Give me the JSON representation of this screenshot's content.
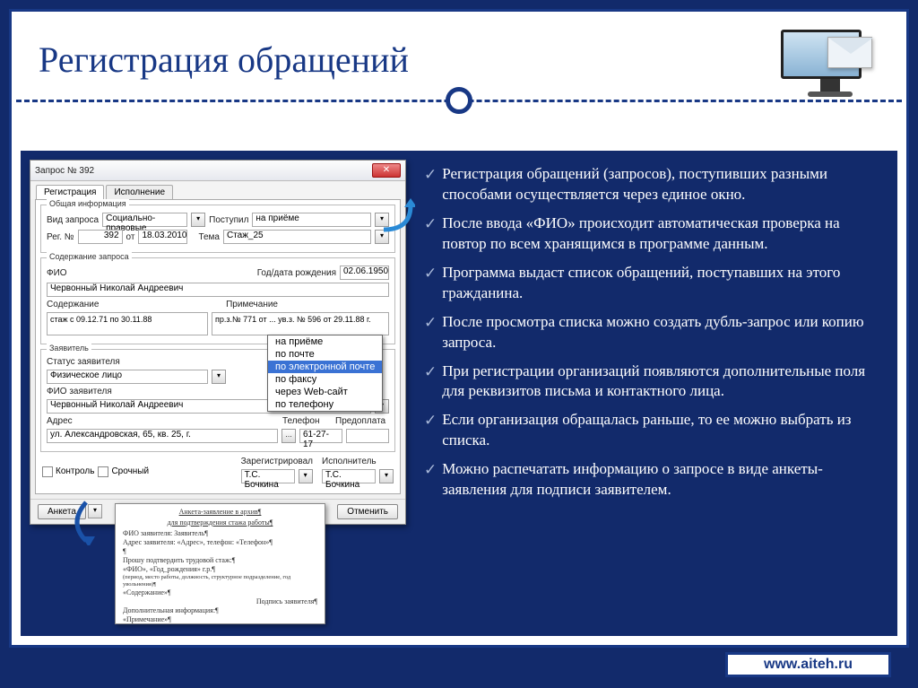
{
  "slide": {
    "title": "Регистрация обращений",
    "footer": "www.aiteh.ru"
  },
  "bullets": [
    "Регистрация обращений (запросов), поступивших разными способами осуществляется через единое  окно.",
    "После ввода «ФИО» происходит автоматическая проверка на повтор по всем хранящимся в программе данным.",
    "Программа выдаст список обращений, поступавших на этого гражданина.",
    "После просмотра списка можно создать дубль-запрос или копию запроса.",
    "При регистрации организаций появляются дополнительные поля для реквизитов письма и контактного лица.",
    "Если организация обращалась раньше, то ее можно выбрать из списка.",
    "Можно распечатать информацию о запросе в виде анкеты-заявления для подписи заявителем."
  ],
  "app": {
    "window_title": "Запрос № 392",
    "tabs": {
      "registration": "Регистрация",
      "execution": "Исполнение"
    },
    "fs_general": "Общая информация",
    "vid_zaprosa_lbl": "Вид запроса",
    "vid_zaprosa_val": "Социально-правовые",
    "postupil_lbl": "Поступил",
    "postupil_val": "на приёме",
    "reg_no_lbl": "Рег. №",
    "reg_no_val": "392",
    "ot_lbl": "от",
    "ot_val": "18.03.2010",
    "tema_lbl": "Тема",
    "tema_val": "Стаж_25",
    "fs_content": "Содержание запроса",
    "fio_lbl": "ФИО",
    "fio_val": "Червонный Николай Андреевич",
    "dob_lbl": "Год/дата рождения",
    "dob_val": "02.06.1950",
    "soder_lbl": "Содержание",
    "soder_val": "стаж с 09.12.71 по 30.11.88",
    "primech_lbl": "Примечание",
    "primech_val": "пр.з.№ 771 от ...\nув.з. № 596 от 29.11.88 г.",
    "fs_applicant": "Заявитель",
    "status_lbl": "Статус заявителя",
    "status_val": "Физическое лицо",
    "fio_zayav_lbl": "ФИО заявителя",
    "fio_zayav_val": "Червонный Николай Андреевич",
    "addr_lbl": "Адрес",
    "addr_val": "ул. Александровская, 65, кв. 25, г.",
    "tel_lbl": "Телефон",
    "tel_val": "61-27-17",
    "predop_lbl": "Предоплата",
    "kontrol_lbl": "Контроль",
    "srochny_lbl": "Срочный",
    "zareg_lbl": "Зарегистрировал",
    "zareg_val": "Т.С. Бочкина",
    "ispol_lbl": "Исполнитель",
    "ispol_val": "Т.С. Бочкина",
    "btn_anketa": "Анкета",
    "btn_cancel": "Отменить"
  },
  "dropdown": {
    "o1": "на приёме",
    "o2": "по почте",
    "o3": "по электронной почте",
    "o4": "по факсу",
    "o5": "через Web-сайт",
    "o6": "по телефону"
  },
  "doc": {
    "l1": "Анкета-заявление в архив¶",
    "l2": "для подтверждения стажа работы¶",
    "l3": "ФИО заявителя: Заявитель¶",
    "l4": "Адрес заявителя: «Адрес», телефон: «Телефон»¶",
    "l5": "Прошу подтвердить трудовой стаж:¶",
    "l6": "«ФИО», «Год_рождения» г.р.¶",
    "l7": "(период, место работы, должность, структурное подразделение, год увольнения)¶",
    "l8": "«Содержание»¶",
    "l9": "Подпись заявителя¶",
    "l10": "Дополнительная информация:¶",
    "l11": "«Примечание»¶"
  }
}
